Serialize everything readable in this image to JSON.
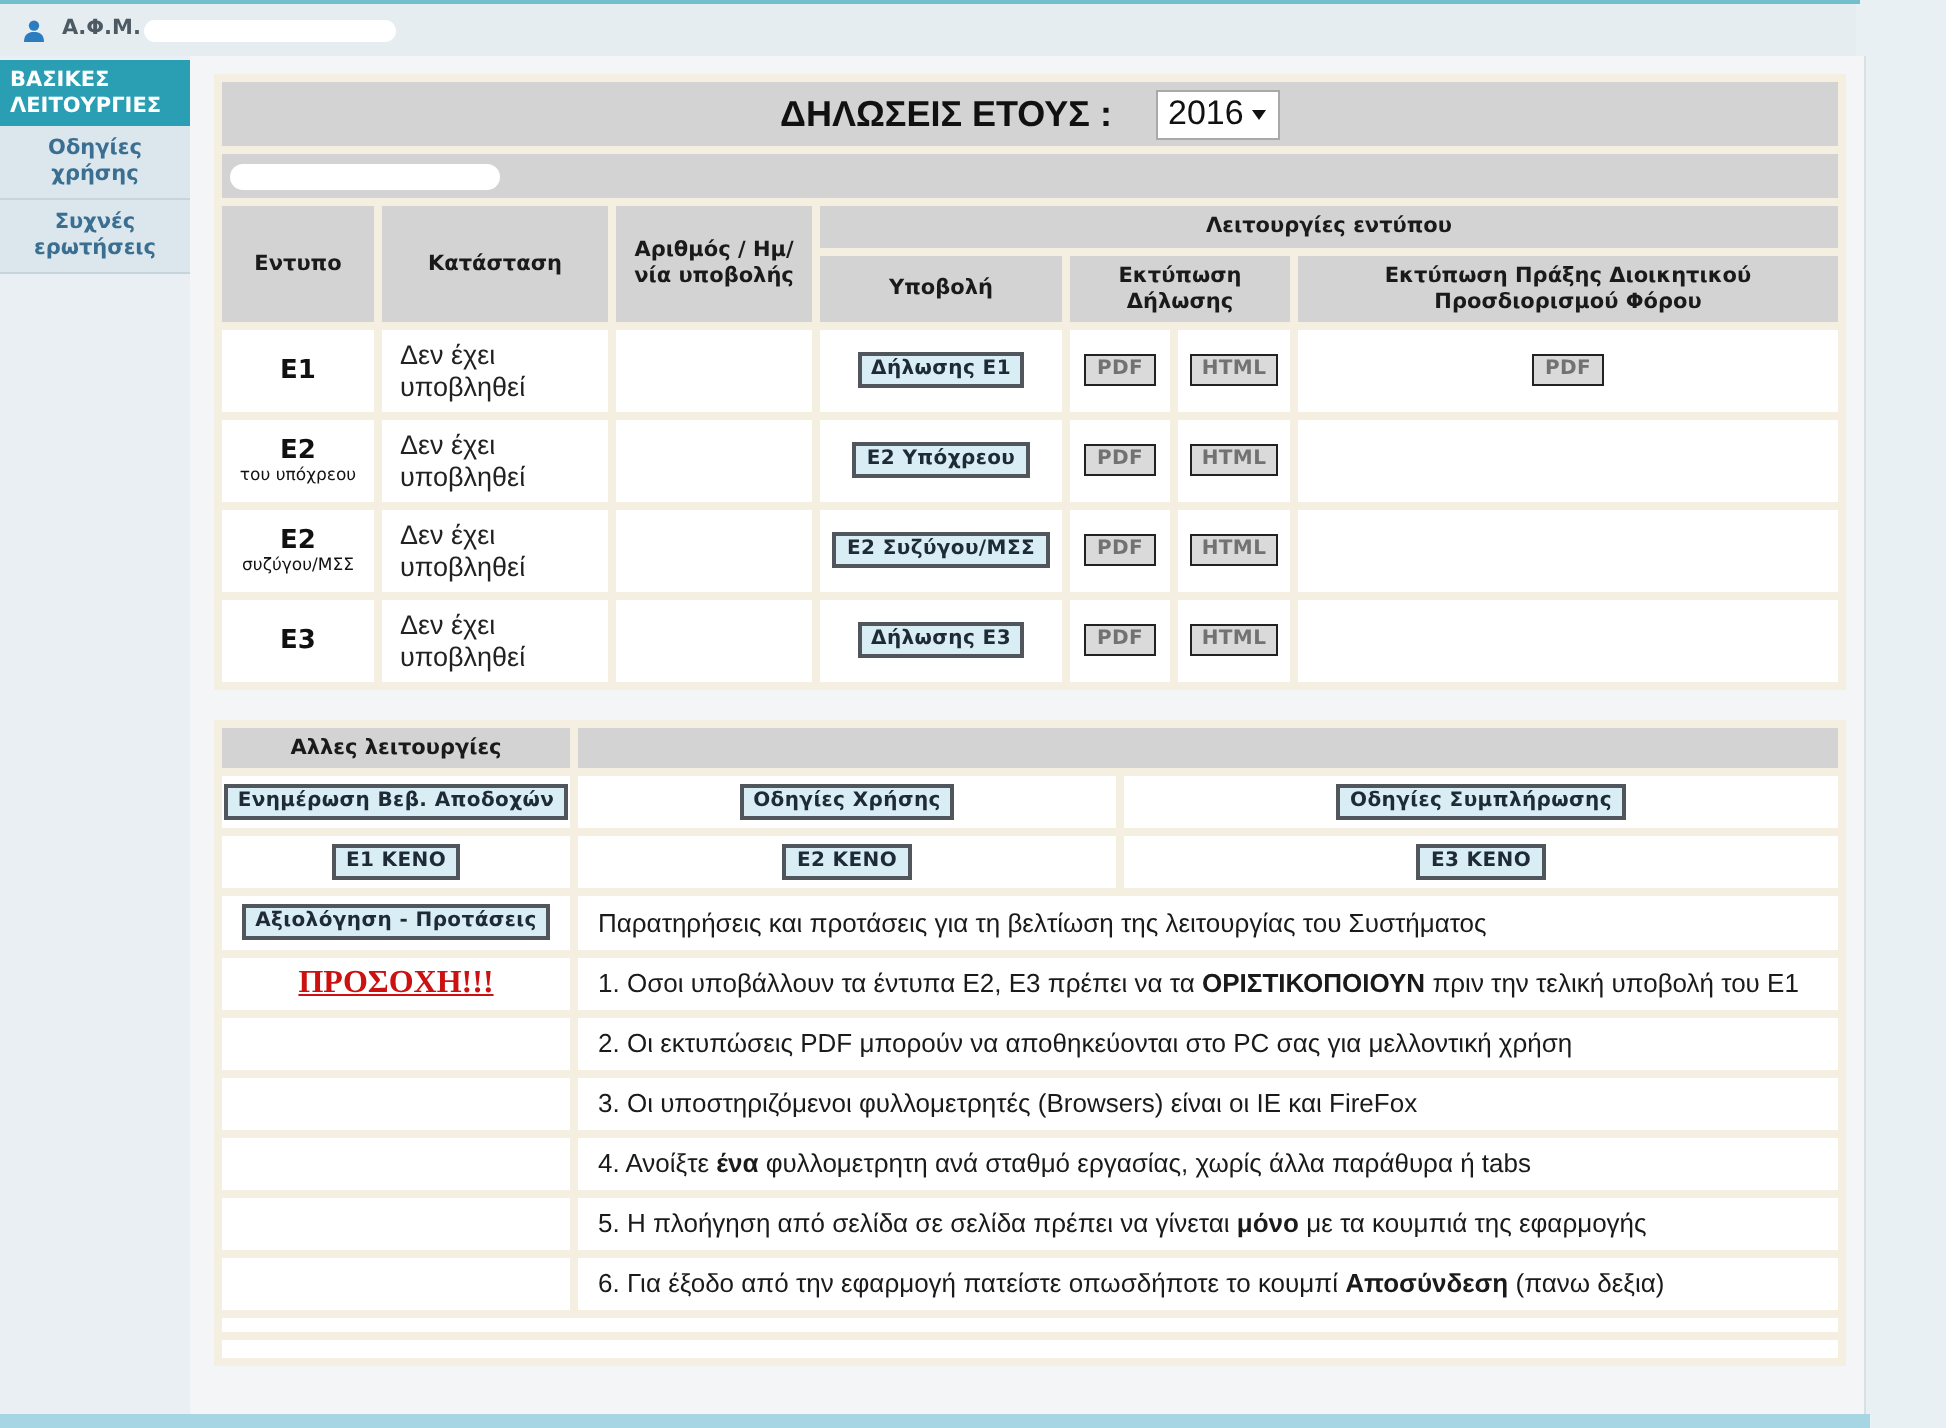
{
  "header": {
    "afm_label": "Α.Φ.Μ."
  },
  "sidebar": {
    "items": [
      {
        "label": "ΒΑΣΙΚΕΣ ΛΕΙΤΟΥΡΓΙΕΣ",
        "selected": true
      },
      {
        "label": "Οδηγίες χρήσης",
        "selected": false
      },
      {
        "label": "Συχνές ερωτήσεις",
        "selected": false
      }
    ]
  },
  "declarations": {
    "title": "ΔΗΛΩΣΕΙΣ ΕΤΟΥΣ :",
    "year_select": {
      "value": "2016"
    },
    "columns": {
      "form": "Εντυπο",
      "status": "Κατάσταση",
      "number_date": "Αριθμός / Ημ/νία υποβολής",
      "functions": "Λειτουργίες εντύπου",
      "submit": "Υποβολή",
      "print": "Εκτύπωση Δήλωσης",
      "act_print": "Εκτύπωση Πράξης Διοικητικού Προσδιορισμού Φόρου"
    },
    "rows": [
      {
        "form": "Ε1",
        "status": "Δεν έχει υποβληθεί",
        "submit_button": {
          "label": "Δήλωσης Ε1",
          "disabled": false
        },
        "print_buttons": [
          {
            "label": "PDF",
            "disabled": true
          },
          {
            "label": "HTML",
            "disabled": true
          }
        ],
        "act_buttons": [
          {
            "label": "PDF",
            "disabled": true
          }
        ]
      },
      {
        "form": "Ε2",
        "form_note": "του υπόχρεου",
        "status": "Δεν έχει υποβληθεί",
        "submit_button": {
          "label": "Ε2 Υπόχρεου",
          "disabled": false
        },
        "print_buttons": [
          {
            "label": "PDF",
            "disabled": true
          },
          {
            "label": "HTML",
            "disabled": true
          }
        ]
      },
      {
        "form": "Ε2",
        "form_note": "συζύγου/ΜΣΣ",
        "status": "Δεν έχει υποβληθεί",
        "submit_button": {
          "label": "Ε2 Συζύγου/ΜΣΣ",
          "disabled": false
        },
        "print_buttons": [
          {
            "label": "PDF",
            "disabled": true
          },
          {
            "label": "HTML",
            "disabled": true
          }
        ]
      },
      {
        "form": "Ε3",
        "status": "Δεν έχει υποβληθεί",
        "submit_button": {
          "label": "Δήλωσης Ε3",
          "disabled": false
        },
        "print_buttons": [
          {
            "label": "PDF",
            "disabled": true
          },
          {
            "label": "HTML",
            "disabled": true
          }
        ]
      }
    ]
  },
  "other_functions": {
    "title": "Αλλες λειτουργίες",
    "button_rows": [
      [
        {
          "label": "Ενημέρωση Βεβ. Αποδοχών"
        },
        {
          "label": "Οδηγίες Χρήσης"
        },
        {
          "label": "Οδηγίες Συμπλήρωσης"
        }
      ],
      [
        {
          "label": "Ε1 ΚΕΝΟ"
        },
        {
          "label": "Ε2 ΚΕΝΟ"
        },
        {
          "label": "Ε3 ΚΕΝΟ"
        }
      ]
    ],
    "feedback_button": {
      "label": "Αξιολόγηση - Προτάσεις"
    },
    "feedback_text": "Παρατηρήσεις και προτάσεις για τη βελτίωση της λειτουργίας του Συστήματος",
    "warning": "ΠΡΟΣΟΧΗ!!!",
    "notes": [
      "1. Οσοι υποβάλλουν τα έντυπα Ε2, Ε3 πρέπει να τα **ΟΡΙΣΤΙΚΟΠΟΙΟΥΝ** πριν την τελική υποβολή του Ε1",
      "2. Οι εκτυπώσεις PDF μπορούν να αποθηκεύονται στο PC σας για μελλοντική χρήση",
      "3. Οι υποστηριζόμενοι φυλλομετρητές (Browsers) είναι οι ΙΕ και FireFox",
      "4. Ανοίξτε **ένα** φυλλομετρητη ανά σταθμό εργασίας, χωρίς άλλα παράθυρα ή tabs",
      "5. Η πλοήγηση από σελίδα σε σελίδα πρέπει να γίνεται **μόνο** με τα κουμπιά της εφαρμογής",
      "6. Για έξοδο από την εφαρμογή πατείστε οπωσδήποτε το κουμπί **Αποσύνδεση** (πανω δεξια)"
    ]
  }
}
